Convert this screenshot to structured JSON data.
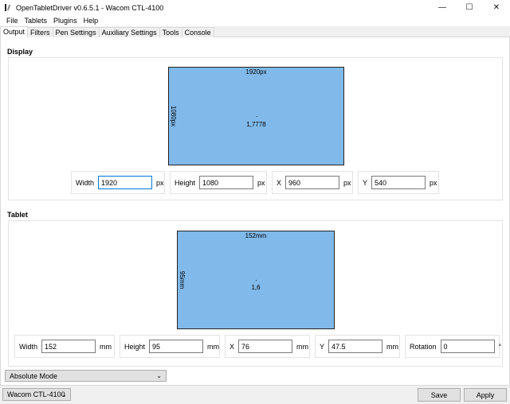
{
  "window": {
    "title": "OpenTabletDriver v0.6.5.1 - Wacom CTL-4100",
    "minimize": "—",
    "maximize": "☐",
    "close": "✕"
  },
  "menu": [
    "File",
    "Tablets",
    "Plugins",
    "Help"
  ],
  "tabs": [
    "Output",
    "Filters",
    "Pen Settings",
    "Auxiliary Settings",
    "Tools",
    "Console"
  ],
  "active_tab": "Output",
  "display": {
    "title": "Display",
    "area": {
      "width_label": "1920px",
      "height_label": "1080px",
      "ratio": "1,7778"
    },
    "fields": {
      "width": {
        "label": "Width",
        "value": "1920",
        "unit": "px"
      },
      "height": {
        "label": "Height",
        "value": "1080",
        "unit": "px"
      },
      "x": {
        "label": "X",
        "value": "960",
        "unit": "px"
      },
      "y": {
        "label": "Y",
        "value": "540",
        "unit": "px"
      }
    }
  },
  "tablet": {
    "title": "Tablet",
    "area": {
      "width_label": "152mm",
      "height_label": "95mm",
      "ratio": "1,6"
    },
    "fields": {
      "width": {
        "label": "Width",
        "value": "152",
        "unit": "mm"
      },
      "height": {
        "label": "Height",
        "value": "95",
        "unit": "mm"
      },
      "x": {
        "label": "X",
        "value": "76",
        "unit": "mm"
      },
      "y": {
        "label": "Y",
        "value": "47.5",
        "unit": "mm"
      },
      "rotation": {
        "label": "Rotation",
        "value": "0",
        "unit": "°"
      }
    }
  },
  "output_mode": {
    "selected": "Absolute Mode",
    "chevron": "⌄"
  },
  "bottom": {
    "tablet_selected": "Wacom CTL-4100",
    "chevron": "⌄",
    "save_label": "Save",
    "apply_label": "Apply"
  },
  "colors": {
    "area_fill": "#80b9ea",
    "focus_border": "#0078d7"
  }
}
